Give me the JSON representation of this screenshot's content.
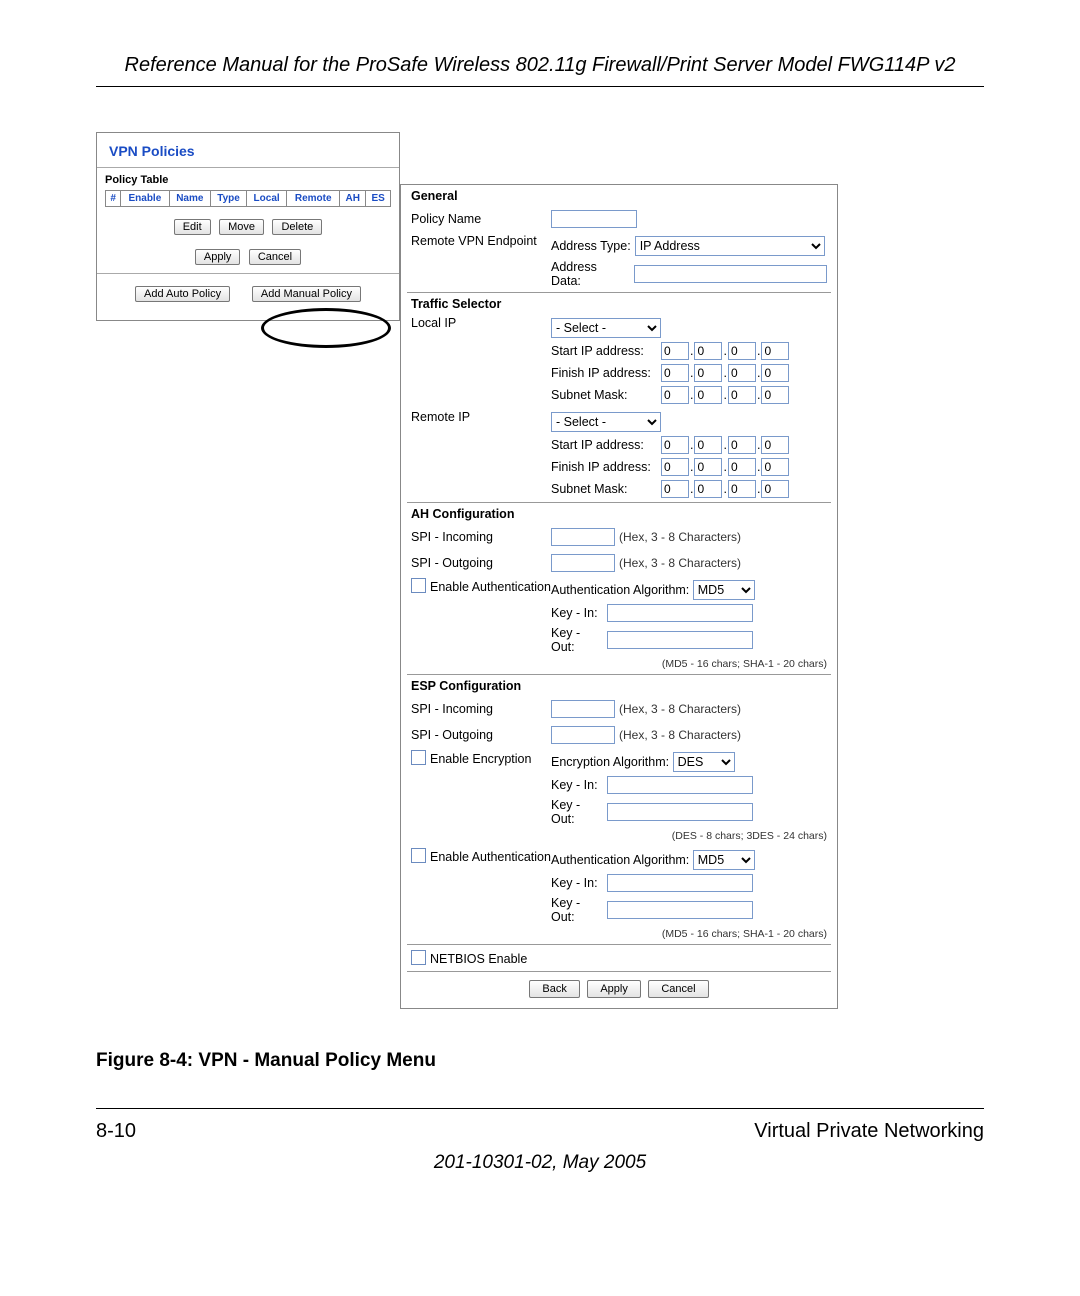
{
  "doc": {
    "header": "Reference Manual for the ProSafe Wireless 802.11g  Firewall/Print Server Model FWG114P v2",
    "figure_caption": "Figure 8-4:  VPN - Manual Policy Menu",
    "page_num": "8-10",
    "section": "Virtual Private Networking",
    "doc_id": "201-10301-02, May 2005"
  },
  "left": {
    "title": "VPN Policies",
    "policy_table_label": "Policy Table",
    "cols": {
      "c1": "#",
      "c2": "Enable",
      "c3": "Name",
      "c4": "Type",
      "c5": "Local",
      "c6": "Remote",
      "c7": "AH",
      "c8": "ES"
    },
    "btn_edit": "Edit",
    "btn_move": "Move",
    "btn_delete": "Delete",
    "btn_apply": "Apply",
    "btn_cancel": "Cancel",
    "btn_add_auto": "Add Auto Policy",
    "btn_add_manual": "Add Manual Policy"
  },
  "form": {
    "general": {
      "title": "General",
      "policy_name": "Policy Name",
      "remote_endpoint": "Remote VPN Endpoint",
      "addr_type_lbl": "Address Type:",
      "addr_type_val": "IP Address",
      "addr_data_lbl": "Address Data:"
    },
    "traffic": {
      "title": "Traffic Selector",
      "local_ip": "Local IP",
      "remote_ip": "Remote IP",
      "select_opt": "- Select -",
      "start_ip": "Start IP address:",
      "finish_ip": "Finish IP address:",
      "subnet": "Subnet Mask:",
      "oct": "0"
    },
    "ah": {
      "title": "AH Configuration",
      "spi_in": "SPI - Incoming",
      "spi_out": "SPI - Outgoing",
      "hex_hint": "(Hex, 3 - 8 Characters)",
      "enable_auth": "Enable Authentication",
      "auth_alg_lbl": "Authentication Algorithm:",
      "auth_alg_val": "MD5",
      "key_in": "Key - In:",
      "key_out": "Key - Out:",
      "key_hint": "(MD5 - 16 chars;   SHA-1 - 20 chars)"
    },
    "esp": {
      "title": "ESP Configuration",
      "spi_in": "SPI - Incoming",
      "spi_out": "SPI - Outgoing",
      "hex_hint": "(Hex, 3 - 8 Characters)",
      "enable_enc": "Enable Encryption",
      "enc_alg_lbl": "Encryption Algorithm:",
      "enc_alg_val": "DES",
      "enc_key_hint": "(DES - 8 chars;   3DES - 24 chars)",
      "enable_auth": "Enable Authentication",
      "auth_alg_lbl": "Authentication Algorithm:",
      "auth_alg_val": "MD5",
      "key_in": "Key - In:",
      "key_out": "Key - Out:",
      "key_hint": "(MD5 - 16 chars;   SHA-1 - 20 chars)"
    },
    "netbios": "NETBIOS Enable",
    "btn_back": "Back",
    "btn_apply": "Apply",
    "btn_cancel": "Cancel"
  }
}
